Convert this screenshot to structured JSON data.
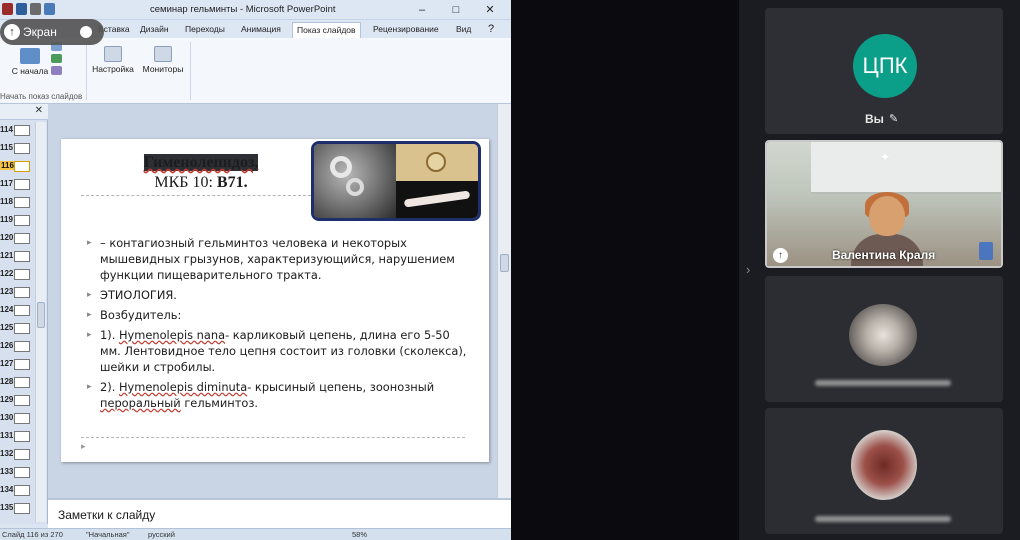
{
  "window": {
    "title": "семинар гельминты - Microsoft PowerPoint",
    "controls": [
      "–",
      "□",
      "✕"
    ]
  },
  "screen_share": {
    "label": "Экран"
  },
  "ribbon": {
    "tabs": [
      "Вставка",
      "Дизайн",
      "Переходы",
      "Анимация",
      "Показ слайдов",
      "Рецензирование",
      "Вид"
    ],
    "active_tab": "Показ слайдов",
    "from_start_label": "С начала",
    "settings_label": "Настройка",
    "monitors_label": "Мониторы",
    "group_label": "Начать показ слайдов"
  },
  "thumbnails": {
    "close": "✕",
    "items": [
      "114",
      "115",
      "116",
      "117",
      "118",
      "119",
      "120",
      "121",
      "122",
      "123",
      "124",
      "125",
      "126",
      "127",
      "128",
      "129",
      "130",
      "131",
      "132",
      "133",
      "134",
      "135"
    ],
    "selected": "116"
  },
  "slide": {
    "title_line1": "Гименолепидоз,",
    "title_line2_a": "МКБ 10:",
    "title_line2_b": "B71.",
    "bullet1": "– контагиозный гельминтоз человека и некоторых мышевидных грызунов, характеризующийся, нарушением функции пищеварительного тракта.",
    "bullet2": "ЭТИОЛОГИЯ.",
    "bullet3": "Возбудитель:",
    "bullet4_pre": "1). ",
    "bullet4_latin": "Hymenolepis nana",
    "bullet4_rest": "- карликовый цепень, длина его 5-50 мм. Лентовидное тело цепня состоит из головки (сколекса), шейки и стробилы.",
    "bullet5_pre": "2). ",
    "bullet5_latin": "Hymenolepis diminuta",
    "bullet5_mid": "- крысиный цепень, зоонозный ",
    "bullet5_und": "пероральный",
    "bullet5_rest": " гельминтоз."
  },
  "notes": {
    "placeholder": "Заметки к слайду"
  },
  "status": {
    "slide": "Слайд 116 из 270",
    "theme": "\"Начальная\"",
    "lang": "русский",
    "zoom": "58%"
  },
  "participants": {
    "self_initials": "ЦПК",
    "self_label": "Вы",
    "speaker_name": "Валентина Краля"
  }
}
